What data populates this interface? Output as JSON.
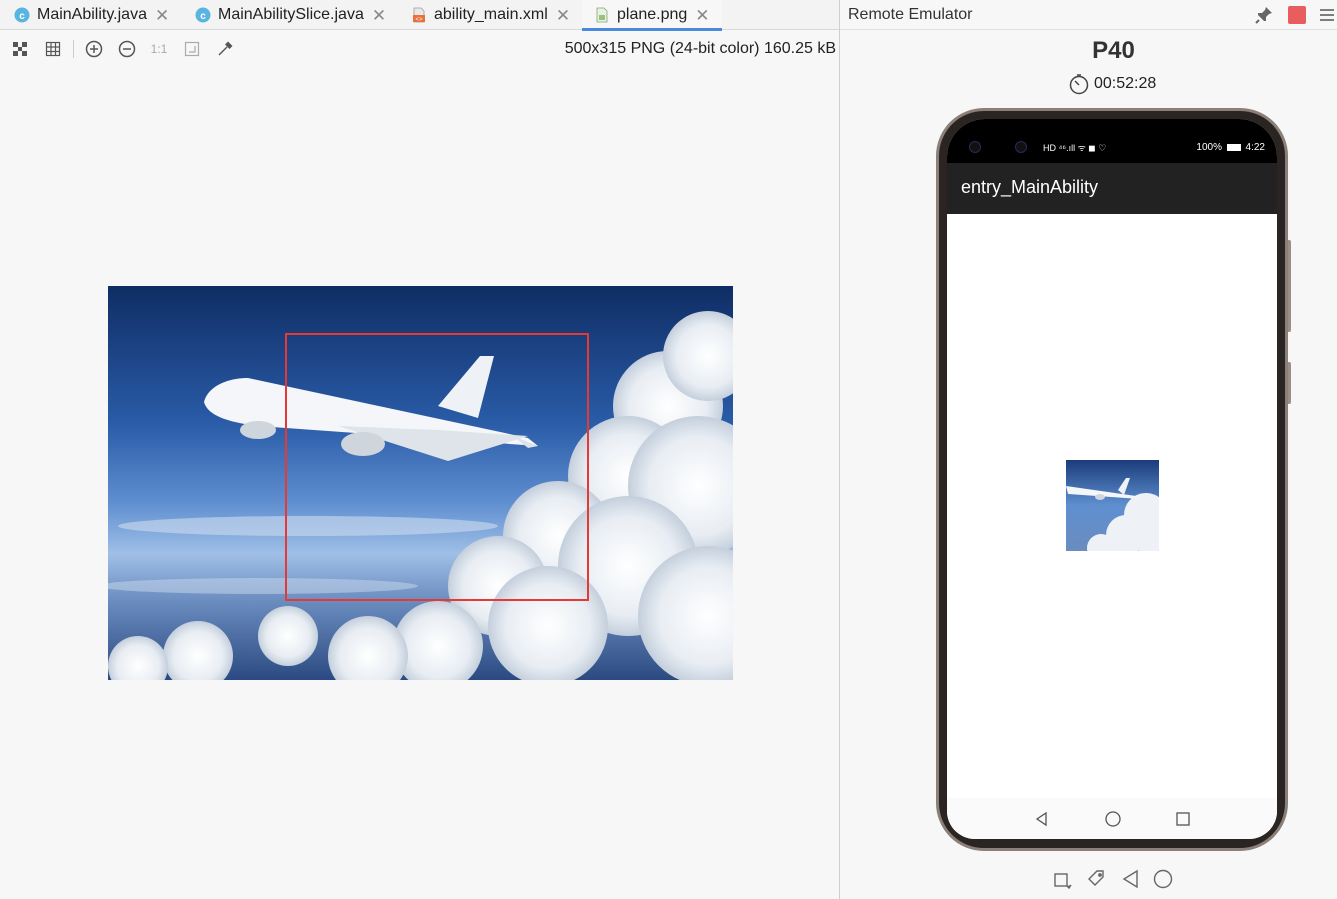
{
  "editor": {
    "tabs": [
      {
        "label": "MainAbility.java",
        "icon": "java-class-icon",
        "active": false
      },
      {
        "label": "MainAbilitySlice.java",
        "icon": "java-class-icon",
        "active": false
      },
      {
        "label": "ability_main.xml",
        "icon": "xml-file-icon",
        "active": false
      },
      {
        "label": "plane.png",
        "icon": "image-file-icon",
        "active": true
      }
    ],
    "toolbar": {
      "actual_size_label": "1:1"
    },
    "image_info": "500x315 PNG (24-bit color) 160.25 kB"
  },
  "emulator": {
    "panel_title": "Remote Emulator",
    "device_name": "P40",
    "timer": "00:52:28",
    "status_bar": {
      "left_icons": "HD ⁴⁶.ıll ᯤ ◼ ♡",
      "battery": "100%",
      "time": "4:22"
    },
    "app_title": "entry_MainAbility"
  },
  "colors": {
    "selection": "#e53935",
    "active_tab_underline": "#4a89dc",
    "stop_button": "#e85d5d"
  }
}
